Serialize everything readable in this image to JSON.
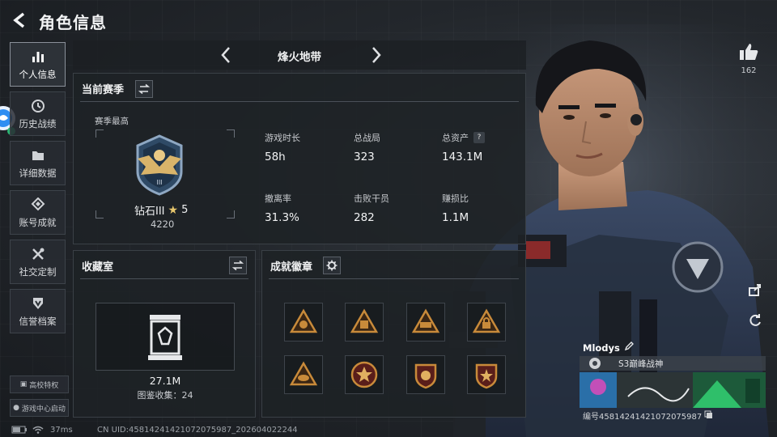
{
  "header": {
    "title": "角色信息"
  },
  "sidebar": {
    "items": [
      {
        "label": "个人信息",
        "icon": "bar-chart-icon",
        "active": true
      },
      {
        "label": "历史战绩",
        "icon": "clock-icon",
        "active": false
      },
      {
        "label": "详细数据",
        "icon": "folder-icon",
        "active": false
      },
      {
        "label": "账号成就",
        "icon": "medal-icon",
        "active": false
      },
      {
        "label": "社交定制",
        "icon": "tools-icon",
        "active": false
      },
      {
        "label": "信誉档案",
        "icon": "shield-icon",
        "active": false
      }
    ],
    "campus_button": "高校特权",
    "game_center_button": "游戏中心启动"
  },
  "season_switch": {
    "name": "烽火地带"
  },
  "current_season": {
    "title": "当前赛季",
    "season_best_label": "赛季最高",
    "rank_name": "钻石III",
    "rank_stars": "5",
    "rank_score": "4220",
    "stats": [
      {
        "label": "游戏时长",
        "value": "58h"
      },
      {
        "label": "总战局",
        "value": "323"
      },
      {
        "label": "总资产",
        "value": "143.1M",
        "help": "?"
      },
      {
        "label": "撤离率",
        "value": "31.3%"
      },
      {
        "label": "击败干员",
        "value": "282"
      },
      {
        "label": "赚损比",
        "value": "1.1M"
      }
    ]
  },
  "collection": {
    "title": "收藏室",
    "value": "27.1M",
    "subtitle": "图鉴收集：24"
  },
  "achievements": {
    "title": "成就徽章",
    "badges": [
      {
        "icon": "triangle-badge-icon",
        "color": "#c88a3a"
      },
      {
        "icon": "triangle-badge-icon",
        "color": "#c88a3a"
      },
      {
        "icon": "triangle-badge-icon",
        "color": "#c88a3a"
      },
      {
        "icon": "triangle-lock-badge-icon",
        "color": "#c88a3a"
      },
      {
        "icon": "triangle-eye-badge-icon",
        "color": "#c88a3a"
      },
      {
        "icon": "round-star-badge-icon",
        "color": "#b24a3a"
      },
      {
        "icon": "shield-badge-icon",
        "color": "#b24a3a"
      },
      {
        "icon": "shield-star-badge-icon",
        "color": "#b24a3a"
      }
    ]
  },
  "likes": {
    "count": "162"
  },
  "player": {
    "name": "Mlodys",
    "title": "S3巅峰战神",
    "id_line": "编号45814241421072075987"
  },
  "status_bar": {
    "ping": "37ms",
    "uid": "CN UID:45814241421072075987_202604022244"
  },
  "colors": {
    "accent": "#c88a3a",
    "panel": "#1e2226",
    "border": "#3a4046"
  }
}
